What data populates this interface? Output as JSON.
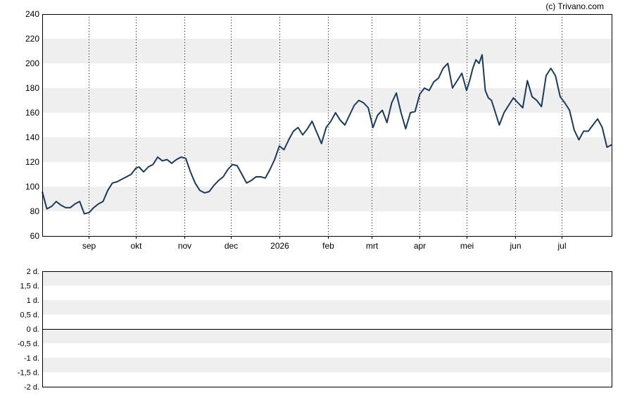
{
  "credit": "(c) Trivano.com",
  "chart_data": [
    {
      "type": "line",
      "ylim": [
        60,
        240
      ],
      "yticks": [
        60,
        80,
        100,
        120,
        140,
        160,
        180,
        200,
        220,
        240
      ],
      "xlim": [
        0,
        365
      ],
      "month_ticks": [
        {
          "label": "sep",
          "x": 30
        },
        {
          "label": "okt",
          "x": 60
        },
        {
          "label": "nov",
          "x": 91
        },
        {
          "label": "dec",
          "x": 121
        },
        {
          "label": "2026",
          "x": 152
        },
        {
          "label": "feb",
          "x": 183
        },
        {
          "label": "mrt",
          "x": 211
        },
        {
          "label": "apr",
          "x": 242
        },
        {
          "label": "mei",
          "x": 272
        },
        {
          "label": "jun",
          "x": 303
        },
        {
          "label": "jul",
          "x": 333
        }
      ],
      "grid": "alternating horizontal bands, dotted vertical lines at month starts",
      "colors": {
        "line": "#1a3a5c",
        "band": "#efefef"
      },
      "series": [
        {
          "x": [
            0,
            3,
            6,
            9,
            12,
            15,
            18,
            21,
            24,
            27,
            30,
            33,
            36,
            39,
            42,
            45,
            48,
            51,
            54,
            57,
            60,
            62,
            65,
            68,
            71,
            74,
            77,
            80,
            83,
            86,
            89,
            92,
            95,
            98,
            101,
            104,
            107,
            110,
            113,
            116,
            119,
            122,
            125,
            128,
            131,
            134,
            137,
            140,
            143,
            146,
            149,
            152,
            155,
            158,
            161,
            164,
            167,
            170,
            173,
            176,
            179,
            182,
            185,
            188,
            191,
            194,
            197,
            200,
            203,
            206,
            209,
            212,
            215,
            218,
            221,
            224,
            227,
            230,
            233,
            236,
            239,
            242,
            245,
            248,
            251,
            254,
            257,
            260,
            263,
            266,
            269,
            272,
            274,
            276,
            278,
            280,
            282,
            284,
            286,
            288,
            290,
            293,
            296,
            299,
            302,
            305,
            308,
            311,
            314,
            317,
            320,
            323,
            326,
            329,
            332,
            335,
            338,
            341,
            344,
            347,
            350,
            353,
            356,
            359,
            362,
            365
          ],
          "y": [
            96,
            82,
            84,
            88,
            85,
            83,
            83,
            86,
            88,
            78,
            79,
            83,
            86,
            88,
            97,
            103,
            104,
            106,
            108,
            110,
            115,
            116,
            112,
            116,
            118,
            124,
            121,
            122,
            119,
            122,
            124,
            123,
            112,
            103,
            97,
            95,
            96,
            101,
            105,
            108,
            114,
            118,
            117,
            110,
            103,
            105,
            108,
            108,
            107,
            114,
            122,
            133,
            130,
            138,
            145,
            148,
            142,
            147,
            153,
            144,
            135,
            148,
            153,
            160,
            154,
            150,
            158,
            166,
            170,
            168,
            164,
            148,
            158,
            162,
            152,
            168,
            176,
            160,
            147,
            160,
            161,
            175,
            180,
            178,
            185,
            188,
            196,
            200,
            180,
            186,
            192,
            178,
            186,
            196,
            203,
            200,
            207,
            178,
            172,
            170,
            162,
            150,
            160,
            166,
            172,
            168,
            164,
            186,
            173,
            170,
            165,
            190,
            196,
            190,
            173,
            168,
            162,
            146,
            138,
            145,
            145,
            150,
            155,
            148,
            132,
            134
          ]
        }
      ]
    },
    {
      "type": "line",
      "ylim": [
        -2,
        2
      ],
      "yticks": [
        {
          "label": "2 d.",
          "v": 2
        },
        {
          "label": "1,5 d.",
          "v": 1.5
        },
        {
          "label": "1 d.",
          "v": 1
        },
        {
          "label": "0,5 d.",
          "v": 0.5
        },
        {
          "label": "0 d.",
          "v": 0
        },
        {
          "label": "-0,5 d.",
          "v": -0.5
        },
        {
          "label": "-1 d.",
          "v": -1
        },
        {
          "label": "-1,5 d.",
          "v": -1.5
        },
        {
          "label": "-2 d.",
          "v": -2
        }
      ],
      "zero_line": 0
    }
  ]
}
